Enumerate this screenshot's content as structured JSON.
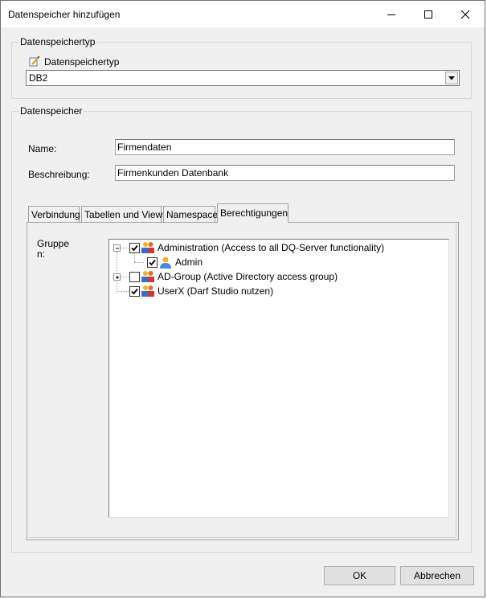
{
  "window": {
    "title": "Datenspeicher hinzufügen",
    "minimize_icon": "minimize-icon",
    "maximize_icon": "maximize-icon",
    "close_icon": "close-icon"
  },
  "type_group": {
    "legend": "Datenspeichertyp",
    "label": "Datenspeichertyp",
    "label_icon": "pencil-edit-icon",
    "selected_value": "DB2"
  },
  "store_group": {
    "legend": "Datenspeicher",
    "name_label": "Name:",
    "name_value": "Firmendaten",
    "description_label": "Beschreibung:",
    "description_value": "Firmenkunden Datenbank"
  },
  "tabs": [
    {
      "label": "Verbindung",
      "active": false
    },
    {
      "label": "Tabellen und Views",
      "active": false
    },
    {
      "label": "Namespace",
      "active": false
    },
    {
      "label": "Berechtigungen",
      "active": true
    }
  ],
  "permissions": {
    "groups_label_line1": "Gruppe",
    "groups_label_line2": "n:",
    "tree": [
      {
        "label": "Administration (Access to all DQ-Server functionality)",
        "checked": true,
        "expanded": true,
        "icon": "user-group-icon"
      },
      {
        "label": "Admin",
        "checked": true,
        "icon": "user-icon"
      },
      {
        "label": "AD-Group (Active Directory access group)",
        "checked": false,
        "expanded": false,
        "icon": "user-group-icon"
      },
      {
        "label": "UserX (Darf Studio nutzen)",
        "checked": true,
        "icon": "user-group-icon"
      }
    ]
  },
  "buttons": {
    "ok": "OK",
    "cancel": "Abbrechen"
  }
}
